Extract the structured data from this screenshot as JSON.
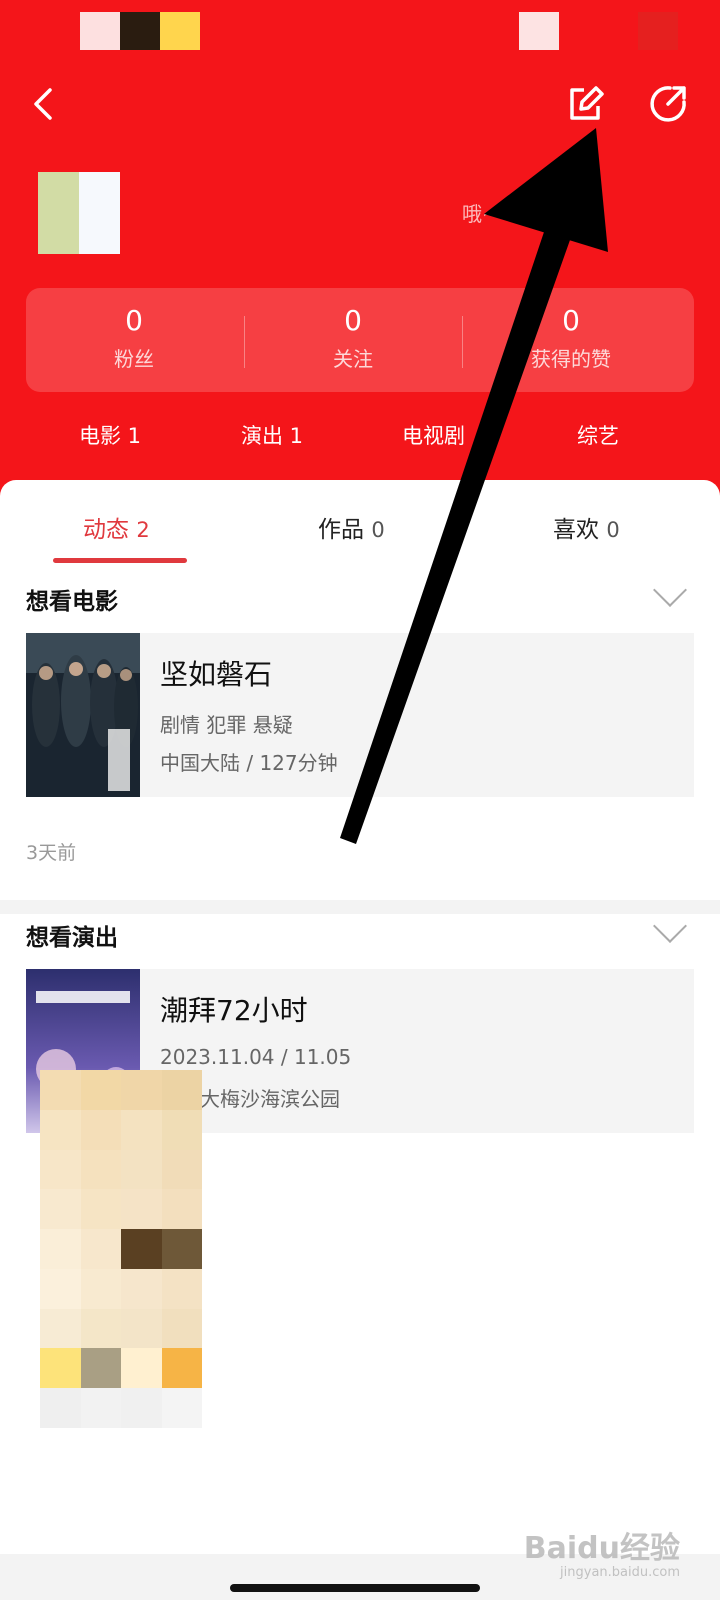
{
  "header": {
    "bio": "哦~",
    "stats": [
      {
        "value": "0",
        "label": "粉丝"
      },
      {
        "value": "0",
        "label": "关注"
      },
      {
        "value": "0",
        "label": "获得的赞"
      }
    ],
    "categories": [
      "电影 1",
      "演出 1",
      "电视剧",
      "综艺"
    ]
  },
  "tabs": [
    {
      "label": "动态",
      "count": "2"
    },
    {
      "label": "作品",
      "count": "0"
    },
    {
      "label": "喜欢",
      "count": "0"
    }
  ],
  "sections": [
    {
      "title": "想看电影",
      "card": {
        "title": "坚如磐石",
        "line1": "剧情 犯罪 悬疑",
        "line2": "中国大陆 / 127分钟"
      },
      "time": "3天前"
    },
    {
      "title": "想看演出",
      "card": {
        "title": "潮拜72小时",
        "line1": "2023.11.04 / 11.05",
        "line2": "深圳大梅沙海滨公园"
      }
    }
  ],
  "watermark": {
    "brand": "Baidu经验",
    "url": "jingyan.baidu.com"
  },
  "colors": {
    "brand_red": "#f4151a",
    "accent": "#e0393e"
  },
  "icons": [
    "back-icon",
    "edit-icon",
    "share-icon",
    "chevron-down-icon"
  ]
}
